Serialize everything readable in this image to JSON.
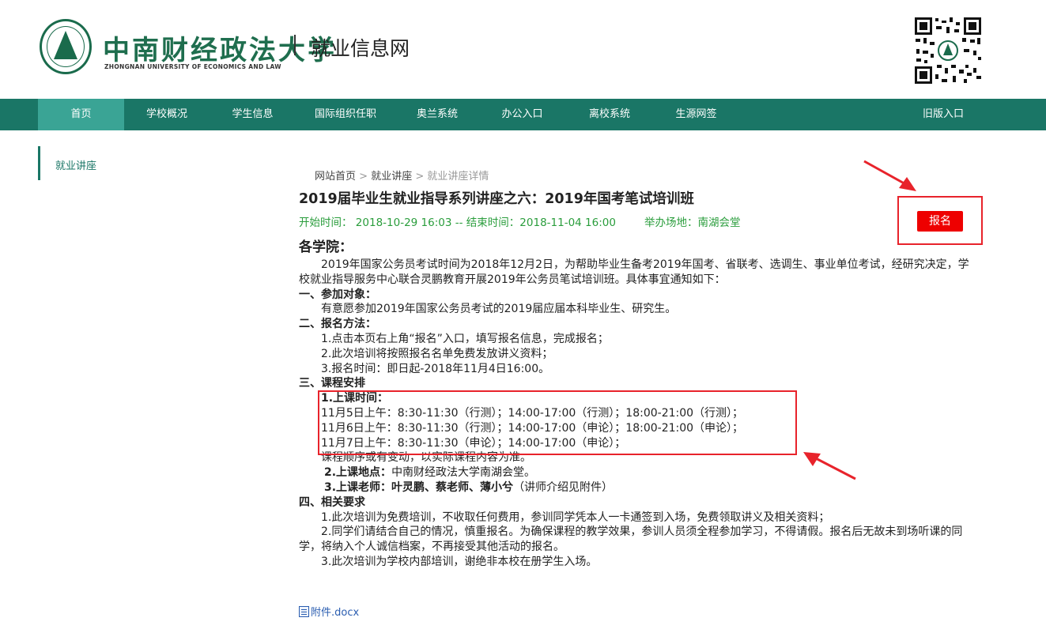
{
  "header": {
    "university_cn": "中南财经政法大学",
    "university_en": "ZHONGNAN UNIVERSITY OF ECONOMICS AND LAW",
    "site_title": "就业信息网"
  },
  "nav": {
    "items": [
      {
        "label": "首页",
        "active": true
      },
      {
        "label": "学校概况"
      },
      {
        "label": "学生信息"
      },
      {
        "label": "国际组织任职"
      },
      {
        "label": "奥兰系统"
      },
      {
        "label": "办公入口"
      },
      {
        "label": "离校系统"
      },
      {
        "label": "生源网签"
      },
      {
        "label": "旧版入口"
      }
    ]
  },
  "sidebar": {
    "items": [
      {
        "label": "就业讲座"
      }
    ]
  },
  "breadcrumb": {
    "home": "网站首页",
    "sep": ">",
    "section": "就业讲座",
    "current": "就业讲座详情"
  },
  "article": {
    "title": "2019届毕业生就业指导系列讲座之六：2019年国考笔试培训班",
    "start_label": "开始时间：",
    "start_time": "2018-10-29 16:03",
    "end_sep": "--",
    "end_label": "结束时间：",
    "end_time": "2018-11-04 16:00",
    "venue_label": "举办场地：",
    "venue": "南湖会堂",
    "signup_label": "报名",
    "greeting": "各学院：",
    "intro": "　　2019年国家公务员考试时间为2018年12月2日，为帮助毕业生备考2019年国考、省联考、选调生、事业单位考试，经研究决定，学校就业指导服务中心联合灵鹏教育开展2019年公务员笔试培训班。具体事宜通知如下：",
    "s1_title": "一、参加对象：",
    "s1_text": "　　有意愿参加2019年国家公务员考试的2019届应届本科毕业生、研究生。",
    "s2_title": "二、报名方法：",
    "s2_items": [
      "　　1.点击本页右上角“报名”入口，填写报名信息，完成报名；",
      "　　2.此次培训将按照报名名单免费发放讲义资料；",
      "　　3.报名时间：即日起-2018年11月4日16:00。"
    ],
    "s3_title": "三、课程安排",
    "s3_time_title": "1.上课时间：",
    "s3_schedule": [
      "11月5日上午：8:30-11:30（行测）；14:00-17:00（行测）；18:00-21:00（行测）；",
      "11月6日上午：8:30-11:30（行测）；14:00-17:00（申论）；18:00-21:00（申论）；",
      "11月7日上午：8:30-11:30（申论）；14:00-17:00（申论）；"
    ],
    "s3_note": "课程顺序或有变动，以实际课程内容为准。",
    "s3_place_title": "2.上课地点：",
    "s3_place": "中南财经政法大学南湖会堂。",
    "s3_teacher_title": "3.上课老师：叶灵鹏、蔡老师、薄小兮",
    "s3_teacher_note": "（讲师介绍见附件）",
    "s4_title": "四、相关要求",
    "s4_items": [
      "　　1.此次培训为免费培训，不收取任何费用，参训同学凭本人一卡通签到入场，免费领取讲义及相关资料；",
      "　　2.同学们请结合自己的情况，慎重报名。为确保课程的教学效果，参训人员须全程参加学习，不得请假。报名后无故未到场听课的同学，将纳入个人诚信档案，不再接受其他活动的报名。",
      "　　3.此次培训为学校内部培训，谢绝非本校在册学生入场。"
    ],
    "attachment": "附件.docx"
  },
  "colors": {
    "nav_bg": "#1a7666",
    "nav_active": "#3aa495",
    "signup_bg": "#ee0000",
    "highlight_border": "#e8232b",
    "meta_green": "#2a9d3c"
  }
}
